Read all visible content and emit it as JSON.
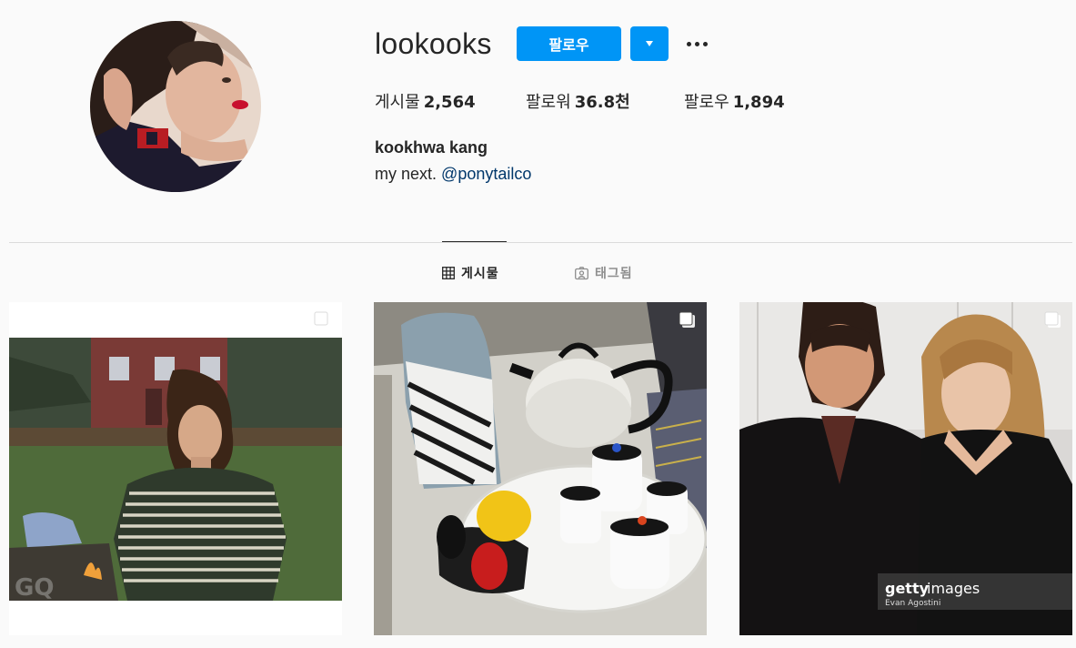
{
  "profile": {
    "username": "lookooks",
    "follow_label": "팔로우",
    "full_name": "kookhwa kang",
    "bio_text": "my next.",
    "bio_mention": "@ponytailco"
  },
  "stats": {
    "posts_label": "게시물",
    "posts_value": "2,564",
    "followers_label": "팔로워",
    "followers_value": "36.8천",
    "following_label": "팔로우",
    "following_value": "1,894"
  },
  "tabs": [
    {
      "label": "게시물",
      "active": true,
      "icon": "grid-icon"
    },
    {
      "label": "태그됨",
      "active": false,
      "icon": "tagged-icon"
    }
  ],
  "posts": [
    {
      "type": "photo",
      "multi": true,
      "watermark": "GQ"
    },
    {
      "type": "photo",
      "multi": true
    },
    {
      "type": "photo",
      "multi": true,
      "watermark": "gettyimages",
      "credit": "Evan Agostini"
    }
  ],
  "colors": {
    "accent": "#0095f6",
    "link": "#00376b",
    "text": "#262626",
    "muted": "#8e8e8e",
    "background": "#fafafa"
  }
}
